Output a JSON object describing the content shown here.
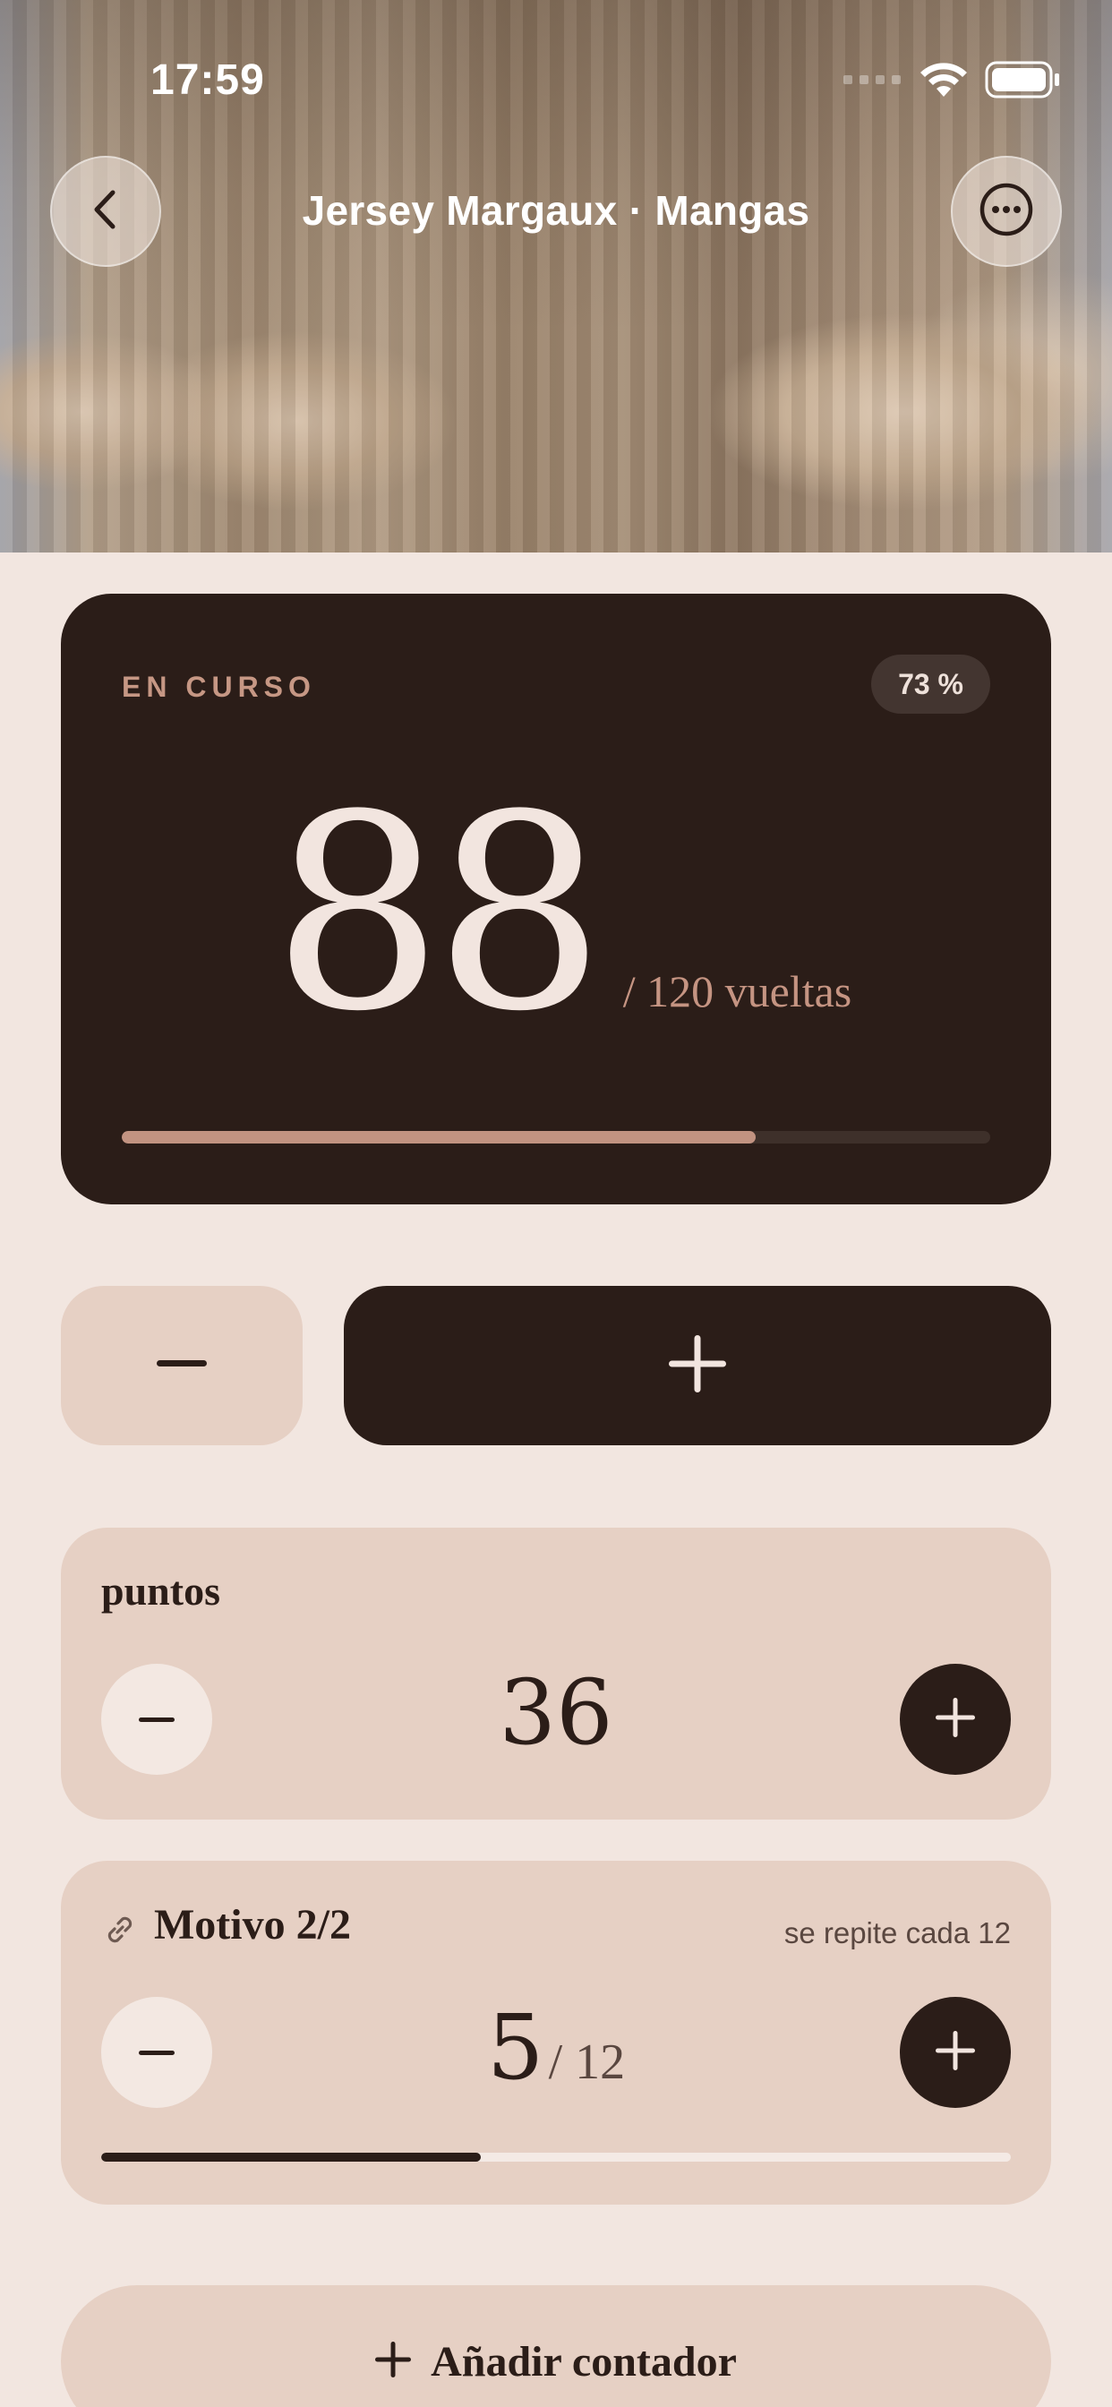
{
  "status_bar": {
    "time": "17:59"
  },
  "header": {
    "title": "Jersey Margaux · Mangas",
    "back_icon": "chevron-left-icon",
    "more_icon": "ellipsis-circle-icon"
  },
  "main_counter": {
    "status": "EN CURSO",
    "percent_label": "73 %",
    "value": "88",
    "total_label": "/ 120 vueltas",
    "progress": 0.73
  },
  "controls": {
    "decrement_icon": "minus-icon",
    "increment_icon": "plus-icon"
  },
  "counters": [
    {
      "name": "puntos",
      "value": "36"
    },
    {
      "name": "Motivo 2/2",
      "repeat_note": "se repite cada 12",
      "value": "5",
      "total": "/ 12",
      "progress": 0.417,
      "icon": "link-icon"
    }
  ],
  "add_button": {
    "label": "Añadir contador",
    "icon": "plus-icon"
  },
  "colors": {
    "accent_dark": "#2b1d18",
    "accent_warm": "#c29381",
    "card": "#e6d0c4",
    "background": "#f2e6e0"
  }
}
